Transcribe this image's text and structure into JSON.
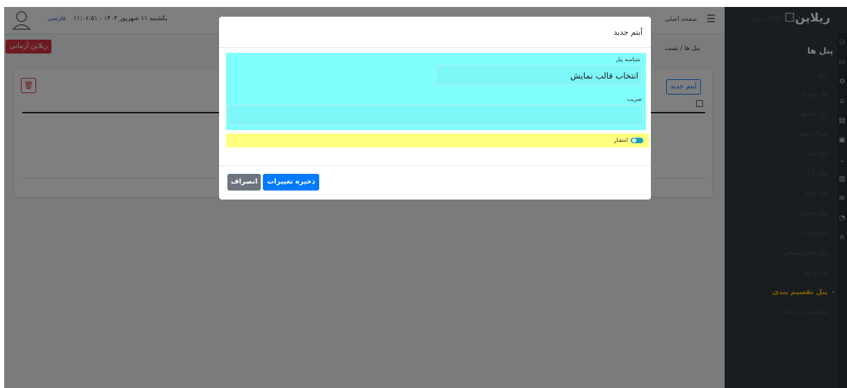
{
  "header": {
    "datetime": "یکشنبه ۱۱ شهریور ۱۴۰۳ - ۱۱:۰۶:۵۱",
    "language": "فارسی",
    "home_link": "صفحه اصلی",
    "user_icon": "user-icon",
    "menu_icon": "hamburger-icon"
  },
  "breadcrumb": {
    "text": "پنل ها / تست",
    "brand_button": "ریلاین آرمانی"
  },
  "card": {
    "new_item_button": "آیتم جدید",
    "delete_icon": "trash-icon"
  },
  "sidebar": {
    "logo": "ریلاین",
    "logo_sub": "نسخه BETA",
    "title": "پنل ها",
    "items": [
      {
        "label": "منو"
      },
      {
        "label": "پنل دوره"
      },
      {
        "label": "پنل محتوا"
      },
      {
        "label": "اسلاید شو"
      },
      {
        "label": "پنل آیتم"
      },
      {
        "label": "متن آزاد"
      },
      {
        "label": "پنل فرم"
      },
      {
        "label": "پنل تماس"
      },
      {
        "label": "اسکریپت"
      },
      {
        "label": "پنل اعتبارسنجی"
      },
      {
        "label": "پنل ورود"
      },
      {
        "label": "پنل تقسیم بندی"
      },
      {
        "label": "موقعیت پنل ها"
      }
    ],
    "active_item": "پنل تقسیم بندی"
  },
  "modal": {
    "title": "آیتم جدید",
    "field_panel_label": "شناسه پنل",
    "field_panel_value": "انتخاب قالب نمایش",
    "field_coef_label": "ضریب",
    "field_coef_value": "",
    "publish_label": "انتشار",
    "publish_on": true,
    "save_button": "ذخیره تغییرات",
    "cancel_button": "انصراف"
  },
  "colors": {
    "sidebar_bg": "#343a40",
    "active": "#ffc107",
    "primary": "#007bff",
    "danger": "#dc3545",
    "cyan_section": "#80ffff",
    "yellow_section": "#ffff80"
  }
}
